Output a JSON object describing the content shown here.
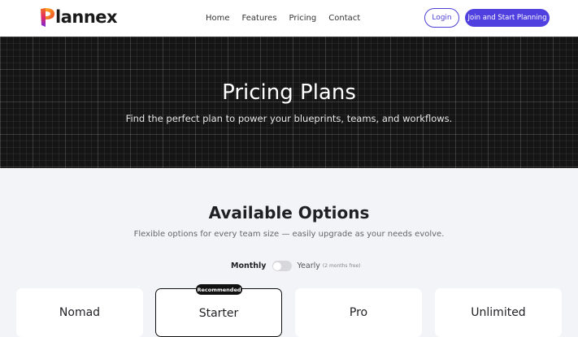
{
  "brand": {
    "name": "lannex",
    "logo_letter": "P"
  },
  "nav": {
    "items": [
      "Home",
      "Features",
      "Pricing",
      "Contact"
    ]
  },
  "header": {
    "login_label": "Login",
    "cta_label": "Join and Start Planning"
  },
  "hero": {
    "title": "Pricing Plans",
    "subtitle": "Find the perfect plan to power your blueprints, teams, and workflows."
  },
  "options": {
    "title": "Available Options",
    "subtitle": "Flexible options for every team size — easily upgrade as your needs evolve."
  },
  "billing": {
    "monthly_label": "Monthly",
    "yearly_label": "Yearly",
    "yearly_note": "(2 months free)",
    "selected": "Monthly"
  },
  "plans": [
    {
      "name": "Nomad",
      "recommended": false
    },
    {
      "name": "Starter",
      "recommended": true,
      "badge": "Recommended"
    },
    {
      "name": "Pro",
      "recommended": false
    },
    {
      "name": "Unlimited",
      "recommended": false
    }
  ],
  "colors": {
    "accent": "#5040e0",
    "hero_bg": "#151515",
    "section_bg": "#f3f4f8"
  }
}
